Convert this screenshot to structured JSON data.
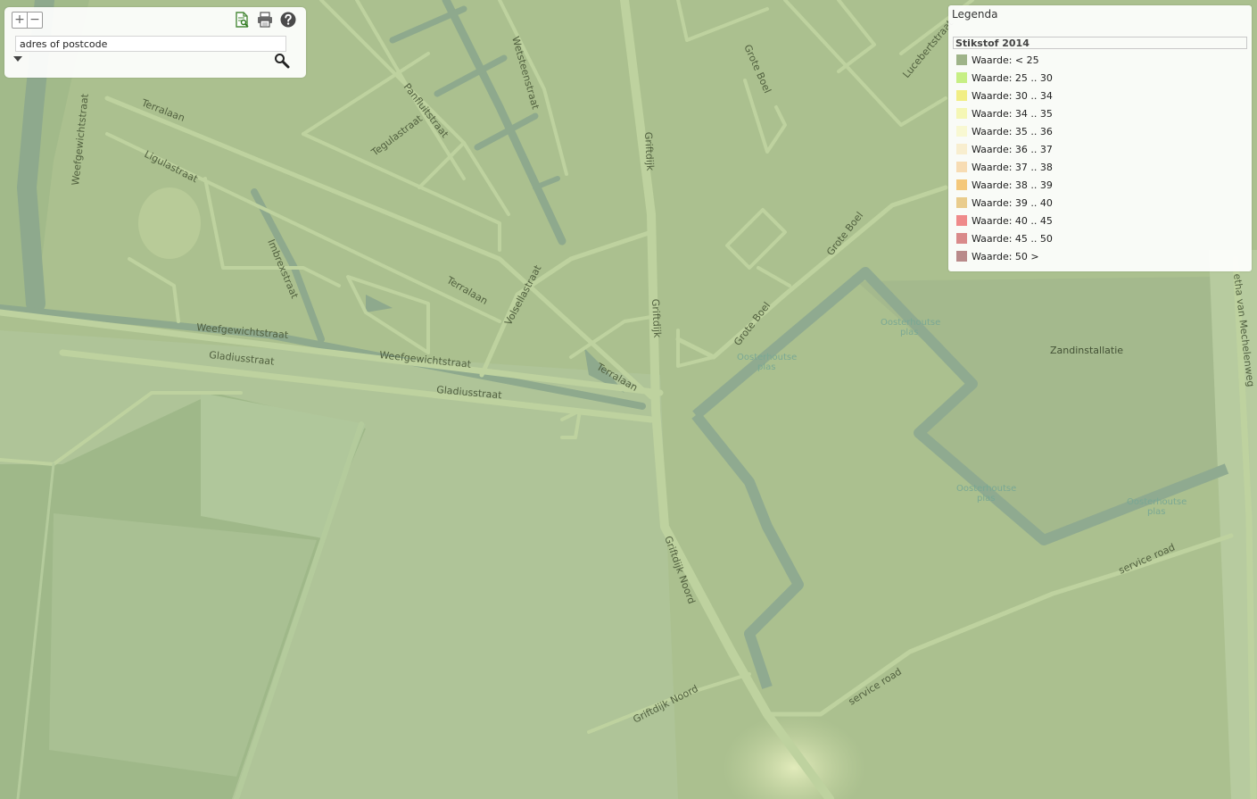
{
  "toolbar": {
    "zoom_in": "+",
    "zoom_out": "−",
    "search_placeholder": "adres of postcode",
    "search_value": "adres of postcode"
  },
  "legend": {
    "title": "Legenda",
    "layer": "Stikstof 2014",
    "items": [
      {
        "label": "Waarde: < 25",
        "color": "#9fb489"
      },
      {
        "label": "Waarde: 25 .. 30",
        "color": "#c7ef84"
      },
      {
        "label": "Waarde: 30 .. 34",
        "color": "#f1ee84"
      },
      {
        "label": "Waarde: 34 .. 35",
        "color": "#f5f7b5"
      },
      {
        "label": "Waarde: 35 .. 36",
        "color": "#f8f8d2"
      },
      {
        "label": "Waarde: 36 .. 37",
        "color": "#f8eecf"
      },
      {
        "label": "Waarde: 37 .. 38",
        "color": "#f7dcb3"
      },
      {
        "label": "Waarde: 38 .. 39",
        "color": "#f4c87a"
      },
      {
        "label": "Waarde: 39 .. 40",
        "color": "#e9cc8c"
      },
      {
        "label": "Waarde: 40 .. 45",
        "color": "#ef8a8a"
      },
      {
        "label": "Waarde: 45 .. 50",
        "color": "#d98a8a"
      },
      {
        "label": "Waarde: 50 >",
        "color": "#b98a8a"
      }
    ]
  },
  "map": {
    "streets": {
      "terralaan": "Terralaan",
      "ligulastraat": "Ligulastraat",
      "weefgewichtstraat": "Weefgewichtstraat",
      "gladiusstraat": "Gladiusstraat",
      "imbrexstraat": "Imbrexstraat",
      "tegulastraat": "Tegulastraat",
      "panfluitstraat": "Panfluitstraat",
      "wetsteenstraat": "Wetsteenstraat",
      "volsellastraat": "Volsellastraat",
      "griftdijk": "Griftdijk",
      "griftdijk_noord": "Griftdijk Noord",
      "grote_boel": "Grote Boel",
      "lucebertstraat": "Lucebertstraat",
      "service_road": "service road",
      "mechelenweg": "etha van Mechelenweg"
    },
    "water": {
      "oosterhoutse_plas": "Oosterhoutse plas",
      "oosterhoutse": "Oosterhoutse",
      "plas": "plas"
    },
    "poi": {
      "zandinstallatie": "Zandinstallatie"
    }
  }
}
